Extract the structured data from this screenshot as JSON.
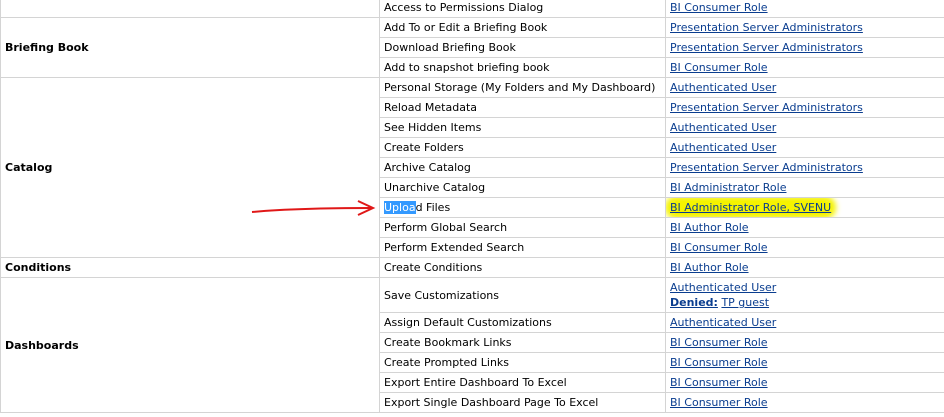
{
  "groups": [
    {
      "name": "",
      "rows": [
        {
          "privilege": "Access to Permissions Dialog",
          "accounts": [
            "BI Consumer Role"
          ]
        }
      ]
    },
    {
      "name": "Briefing Book",
      "rows": [
        {
          "privilege": "Add To or Edit a Briefing Book",
          "accounts": [
            "Presentation Server Administrators"
          ]
        },
        {
          "privilege": "Download Briefing Book",
          "accounts": [
            "Presentation Server Administrators"
          ]
        },
        {
          "privilege": "Add to snapshot briefing book",
          "accounts": [
            "BI Consumer Role"
          ]
        }
      ]
    },
    {
      "name": "Catalog",
      "rows": [
        {
          "privilege": "Personal Storage (My Folders and My Dashboard)",
          "accounts": [
            "Authenticated User"
          ]
        },
        {
          "privilege": "Reload Metadata",
          "accounts": [
            "Presentation Server Administrators"
          ]
        },
        {
          "privilege": "See Hidden Items",
          "accounts": [
            "Authenticated User"
          ]
        },
        {
          "privilege": "Create Folders",
          "accounts": [
            "Authenticated User"
          ]
        },
        {
          "privilege": "Archive Catalog",
          "accounts": [
            "Presentation Server Administrators"
          ]
        },
        {
          "privilege": "Unarchive Catalog",
          "accounts": [
            "BI Administrator Role"
          ]
        },
        {
          "privilege": "Upload Files",
          "privilege_selected": "Uploa",
          "privilege_rest": "d Files",
          "accounts": [
            "BI Administrator Role, SVENU"
          ],
          "highlighted": true
        },
        {
          "privilege": "Perform Global Search",
          "accounts": [
            "BI Author Role"
          ]
        },
        {
          "privilege": "Perform Extended Search",
          "accounts": [
            "BI Consumer Role"
          ]
        }
      ]
    },
    {
      "name": "Conditions",
      "rows": [
        {
          "privilege": "Create Conditions",
          "accounts": [
            "BI Author Role"
          ]
        }
      ]
    },
    {
      "name": "Dashboards",
      "rows": [
        {
          "privilege": "Save Customizations",
          "accounts": [
            "Authenticated User"
          ],
          "denied_label": "Denied:",
          "denied_account": "TP guest"
        },
        {
          "privilege": "Assign Default Customizations",
          "accounts": [
            "Authenticated User"
          ]
        },
        {
          "privilege": "Create Bookmark Links",
          "accounts": [
            "BI Consumer Role"
          ]
        },
        {
          "privilege": "Create Prompted Links",
          "accounts": [
            "BI Consumer Role"
          ]
        },
        {
          "privilege": "Export Entire Dashboard To Excel",
          "accounts": [
            "BI Consumer Role"
          ]
        },
        {
          "privilege": "Export Single Dashboard Page To Excel",
          "accounts": [
            "BI Consumer Role"
          ]
        }
      ]
    }
  ],
  "colors": {
    "link": "#0a3d8f",
    "highlight": "#f5f300",
    "selection": "#3399ff",
    "arrow": "#e01818",
    "border": "#d4d4d4"
  }
}
